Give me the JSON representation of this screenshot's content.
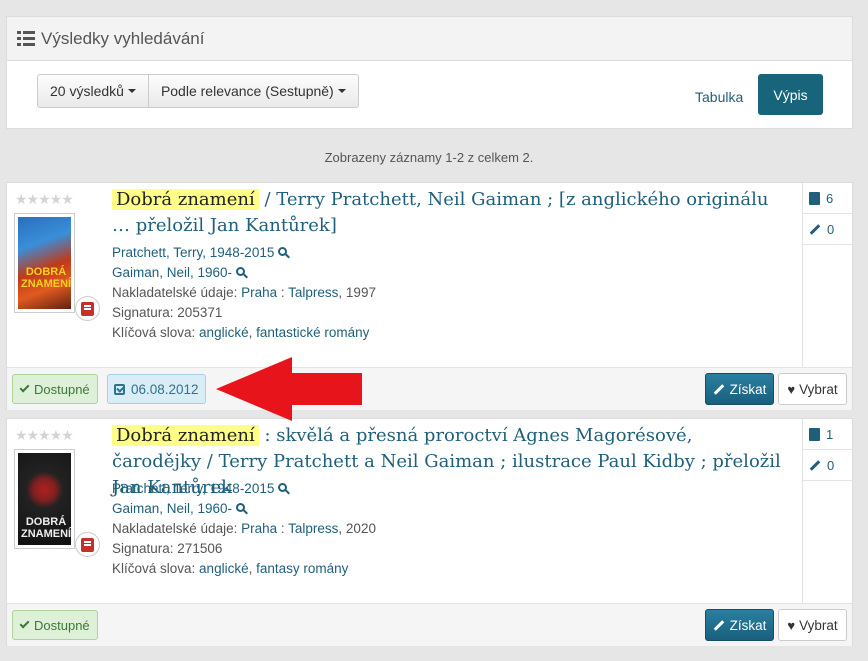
{
  "header": {
    "title": "Výsledky vyhledávání",
    "icon": "list-icon"
  },
  "toolbar": {
    "limit_label": "20 výsledků",
    "sort_label": "Podle relevance (Sestupně)",
    "view_table": "Tabulka",
    "view_list": "Výpis"
  },
  "summary": "Zobrazeny záznamy 1-2 z celkem 2.",
  "records": [
    {
      "highlight": "Dobrá  znamení",
      "title_rest": " / Terry Pratchett, Neil Gaiman ; [z anglického originálu … přeložil Jan Kantůrek]",
      "cover_text": "DOBRÁ ZNAMENÍ",
      "author1": "Pratchett, Terry, 1948-2015",
      "author2": "Gaiman, Neil, 1960-",
      "publisher_label": "Nakladatelské údaje: ",
      "pub_place": "Praha",
      "pub_sep": " : ",
      "pub_name": "Talpress",
      "pub_year": ", 1997",
      "signature_label": "Signatura: ",
      "signature": "205371",
      "keywords_label": "Klíčová slova: ",
      "kw1": "anglické",
      "kw_sep": ", ",
      "kw2": "fantastické romány",
      "copies": "6",
      "reviews": "0",
      "availability": "Dostupné",
      "date": "06.08.2012",
      "get_label": "Získat",
      "pick_label": "Vybrat"
    },
    {
      "highlight": "Dobrá  znamení",
      "title_rest": " : skvělá a přesná proroctví Agnes Magorésové, čarodějky / Terry Pratchett a Neil Gaiman ; ilustrace Paul Kidby ; přeložil Jan Kantůrek",
      "cover_text": "DOBRÁ ZNAMENÍ",
      "author1": "Pratchett, Terry, 1948-2015",
      "author2": "Gaiman, Neil, 1960-",
      "publisher_label": "Nakladatelské údaje: ",
      "pub_place": "Praha",
      "pub_sep": " : ",
      "pub_name": "Talpress",
      "pub_year": ", 2020",
      "signature_label": "Signatura: ",
      "signature": "271506",
      "keywords_label": "Klíčová slova: ",
      "kw1": "anglické",
      "kw_sep": ", ",
      "kw2": "fantasy romány",
      "copies": "1",
      "reviews": "0",
      "availability": "Dostupné",
      "get_label": "Získat",
      "pick_label": "Vybrat"
    }
  ],
  "colors": {
    "accent": "#17647b",
    "highlight": "#ffff88",
    "arrow": "#e8141b",
    "available": "#dff0d8"
  }
}
